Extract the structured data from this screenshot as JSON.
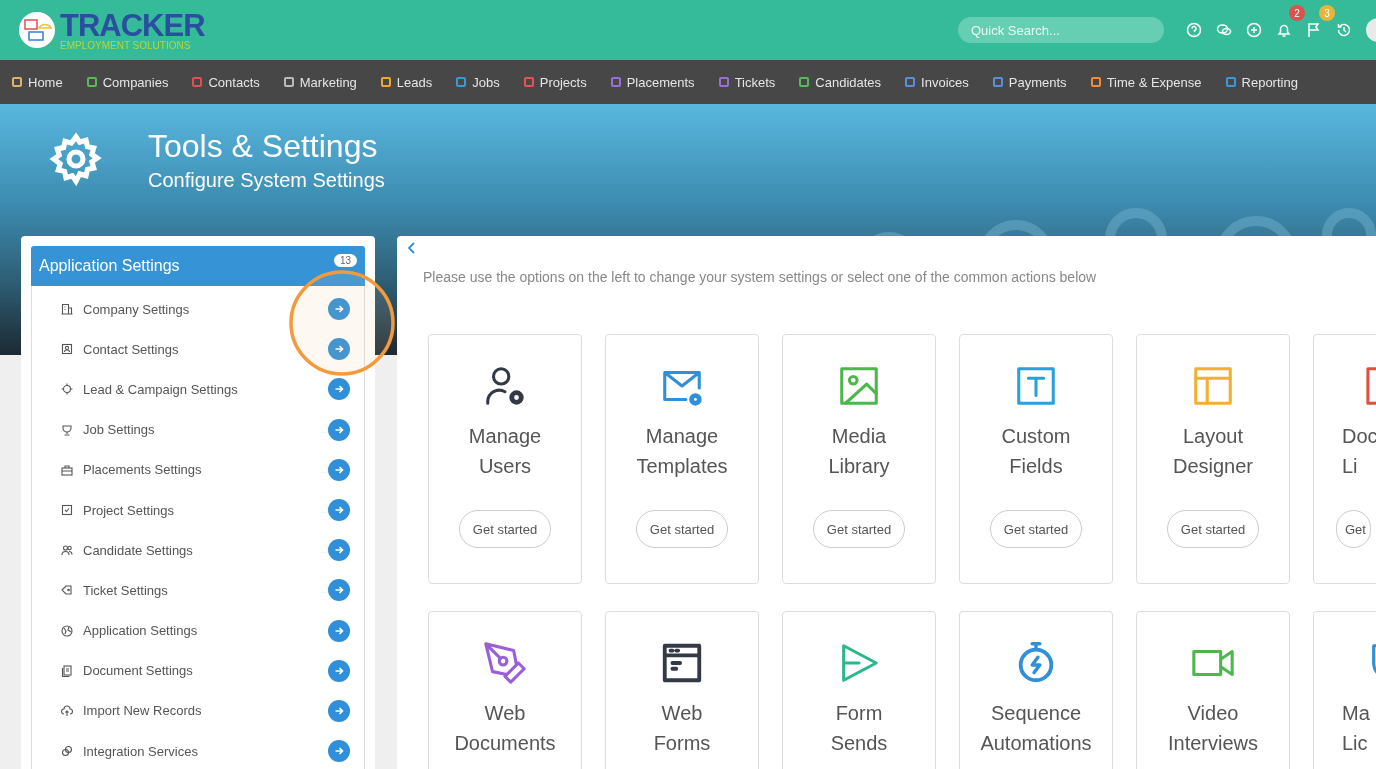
{
  "header": {
    "logo": {
      "name": "TRACKER",
      "tagline": "EMPLOYMENT SOLUTIONS"
    },
    "search": {
      "placeholder": "Quick Search..."
    },
    "icons": [
      {
        "kind": "help"
      },
      {
        "kind": "chat"
      },
      {
        "kind": "add"
      },
      {
        "kind": "bell",
        "badge": "2",
        "color": "#d9534f"
      },
      {
        "kind": "flag",
        "badge": "3",
        "color": "#e8b53a"
      },
      {
        "kind": "history"
      },
      {
        "kind": "avatar"
      }
    ]
  },
  "nav": [
    {
      "label": "Home",
      "color": "#e0b070"
    },
    {
      "label": "Companies",
      "color": "#5cb85c"
    },
    {
      "label": "Contacts",
      "color": "#d9534f"
    },
    {
      "label": "Marketing",
      "color": "#bbbbbb"
    },
    {
      "label": "Leads",
      "color": "#f0a830"
    },
    {
      "label": "Jobs",
      "color": "#3a9ad9"
    },
    {
      "label": "Projects",
      "color": "#e05555"
    },
    {
      "label": "Placements",
      "color": "#9b6fd6"
    },
    {
      "label": "Tickets",
      "color": "#9b6fd6"
    },
    {
      "label": "Candidates",
      "color": "#5cb85c"
    },
    {
      "label": "Invoices",
      "color": "#5b8fd9"
    },
    {
      "label": "Payments",
      "color": "#5b8fd9"
    },
    {
      "label": "Time & Expense",
      "color": "#f08a3c"
    },
    {
      "label": "Reporting",
      "color": "#3a9ad9"
    }
  ],
  "banner": {
    "title": "Tools & Settings",
    "subtitle": "Configure System Settings"
  },
  "sidebar": {
    "title": "Application Settings",
    "count": "13",
    "items": [
      {
        "label": "Company Settings",
        "kind": "building"
      },
      {
        "label": "Contact Settings",
        "kind": "contact"
      },
      {
        "label": "Lead & Campaign Settings",
        "kind": "target"
      },
      {
        "label": "Job Settings",
        "kind": "trophy"
      },
      {
        "label": "Placements Settings",
        "kind": "briefcase"
      },
      {
        "label": "Project Settings",
        "kind": "check"
      },
      {
        "label": "Candidate Settings",
        "kind": "people"
      },
      {
        "label": "Ticket Settings",
        "kind": "tag"
      },
      {
        "label": "Application Settings",
        "kind": "globe"
      },
      {
        "label": "Document Settings",
        "kind": "docs"
      },
      {
        "label": "Import New Records",
        "kind": "cloud"
      },
      {
        "label": "Integration Services",
        "kind": "link"
      }
    ]
  },
  "main": {
    "intro": "Please use the options on the left to change your system settings or select one of the common actions below",
    "actions": [
      {
        "title": [
          "Manage",
          "Users"
        ],
        "button": "Get started",
        "kind": "user-gear",
        "color": "#333a45"
      },
      {
        "title": [
          "Manage",
          "Templates"
        ],
        "button": "Get started",
        "kind": "mail-gear",
        "color": "#2f8fd8"
      },
      {
        "title": [
          "Media",
          "Library"
        ],
        "button": "Get started",
        "kind": "image",
        "color": "#4cb84c"
      },
      {
        "title": [
          "Custom",
          "Fields"
        ],
        "button": "Get started",
        "kind": "text",
        "color": "#2aa0d8"
      },
      {
        "title": [
          "Layout",
          "Designer"
        ],
        "button": "Get started",
        "kind": "layout",
        "color": "#f0b030"
      },
      {
        "title": [
          "Doc",
          "Li"
        ],
        "button": "Get",
        "kind": "doc",
        "color": "#e05040"
      },
      {
        "title": [
          "Web",
          "Documents"
        ],
        "kind": "pen",
        "color": "#9a5fd6"
      },
      {
        "title": [
          "Web",
          "Forms"
        ],
        "kind": "browser",
        "color": "#333a45"
      },
      {
        "title": [
          "Form",
          "Sends"
        ],
        "kind": "send",
        "color": "#2ab88a"
      },
      {
        "title": [
          "Sequence",
          "Automations"
        ],
        "kind": "stopwatch",
        "color": "#2f8fd8"
      },
      {
        "title": [
          "Video",
          "Interviews"
        ],
        "kind": "video",
        "color": "#4cb84c"
      },
      {
        "title": [
          "Ma",
          "Lic"
        ],
        "kind": "shield",
        "color": "#2f8fd8"
      }
    ]
  }
}
